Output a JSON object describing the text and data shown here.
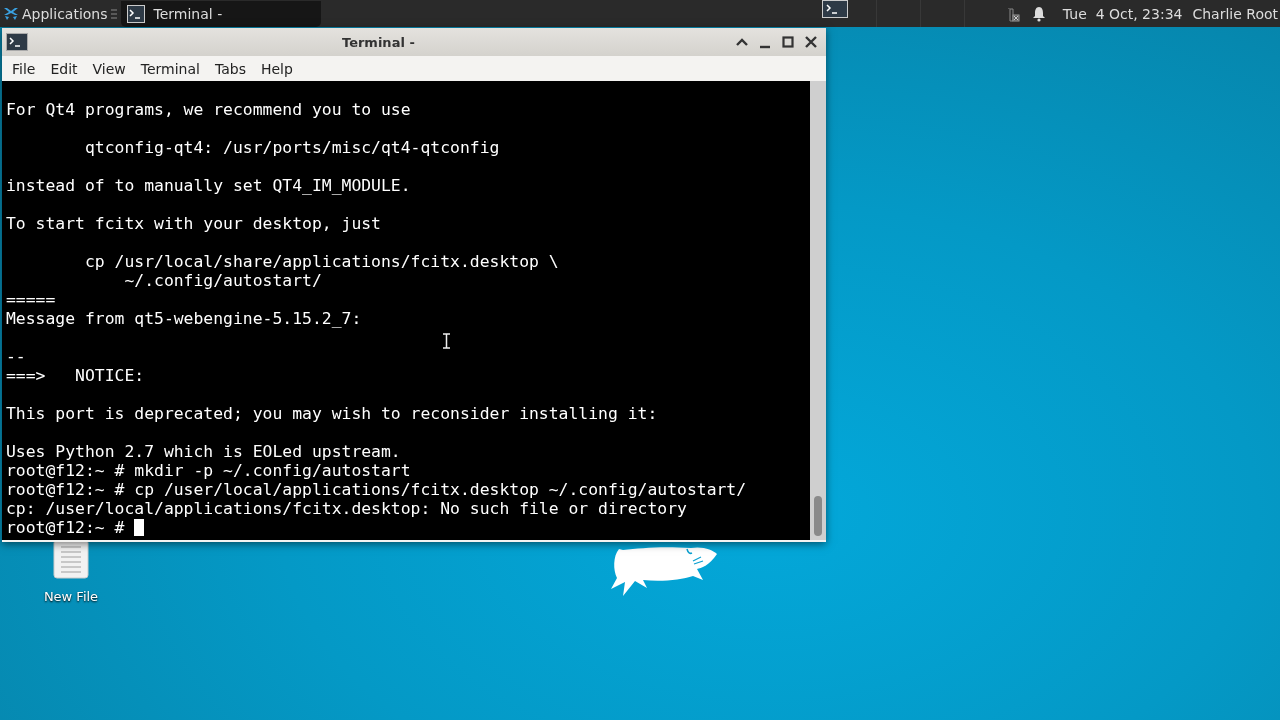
{
  "panel": {
    "applications_label": "Applications",
    "task": {
      "label": "Terminal -",
      "selected": true
    },
    "clock": "Tue  4 Oct, 23:34",
    "user": "Charlie Root"
  },
  "window": {
    "title": "Terminal -",
    "menu": [
      "File",
      "Edit",
      "View",
      "Terminal",
      "Tabs",
      "Help"
    ]
  },
  "terminal": {
    "blocks": [
      [
        "For Qt4 programs, we recommend you to use"
      ],
      [
        "        qtconfig-qt4: /usr/ports/misc/qt4-qtconfig"
      ],
      [
        "instead of to manually set QT4_IM_MODULE."
      ],
      [
        "To start fcitx with your desktop, just"
      ],
      [
        "        cp /usr/local/share/applications/fcitx.desktop \\",
        "            ~/.config/autostart/",
        "=====",
        "Message from qt5-webengine-5.15.2_7:"
      ],
      [
        "--",
        "===>   NOTICE:"
      ],
      [
        "This port is deprecated; you may wish to reconsider installing it:"
      ],
      [
        "Uses Python 2.7 which is EOLed upstream.",
        "root@f12:~ # mkdir -p ~/.config/autostart",
        "root@f12:~ # cp /user/local/applications/fcitx.desktop ~/.config/autostart/",
        "cp: /user/local/applications/fcitx.desktop: No such file or directory"
      ]
    ],
    "prompt": "root@f12:~ # "
  },
  "desktop_icons": [
    {
      "label": "New File"
    }
  ]
}
